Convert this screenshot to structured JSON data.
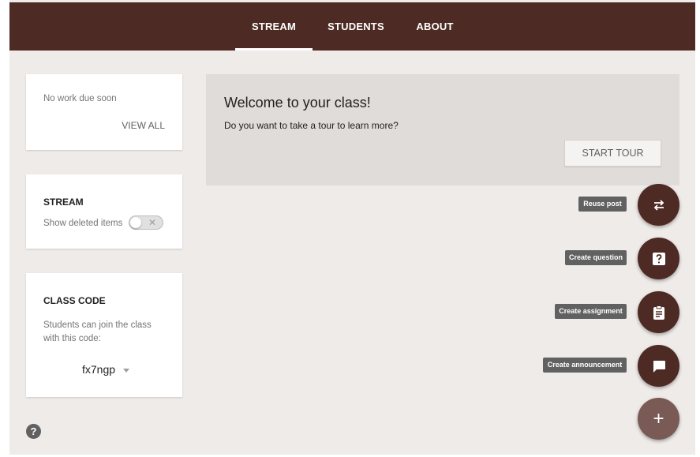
{
  "tabs": [
    {
      "label": "STREAM",
      "active": true
    },
    {
      "label": "STUDENTS",
      "active": false
    },
    {
      "label": "ABOUT",
      "active": false
    }
  ],
  "upcoming": {
    "empty_text": "No work due soon",
    "view_all": "VIEW ALL"
  },
  "stream_card": {
    "title": "STREAM",
    "toggle_label": "Show deleted items",
    "toggle_on": false
  },
  "class_code": {
    "title": "CLASS CODE",
    "description": "Students can join the class with this code:",
    "code": "fx7ngp"
  },
  "welcome": {
    "title": "Welcome to your class!",
    "subtitle": "Do you want to take a tour to learn more?",
    "button": "START TOUR"
  },
  "actions": [
    {
      "label": "Reuse post",
      "icon": "repeat-icon"
    },
    {
      "label": "Create question",
      "icon": "question-icon"
    },
    {
      "label": "Create assignment",
      "icon": "clipboard-icon"
    },
    {
      "label": "Create announcement",
      "icon": "chat-icon"
    }
  ],
  "main_fab": {
    "icon": "plus-icon",
    "symbol": "+"
  },
  "help": {
    "icon": "help-icon",
    "symbol": "?"
  },
  "colors": {
    "primary": "#4e2a24",
    "background": "#efebe9",
    "fab_main": "#7a5a55",
    "tooltip": "#616161"
  }
}
